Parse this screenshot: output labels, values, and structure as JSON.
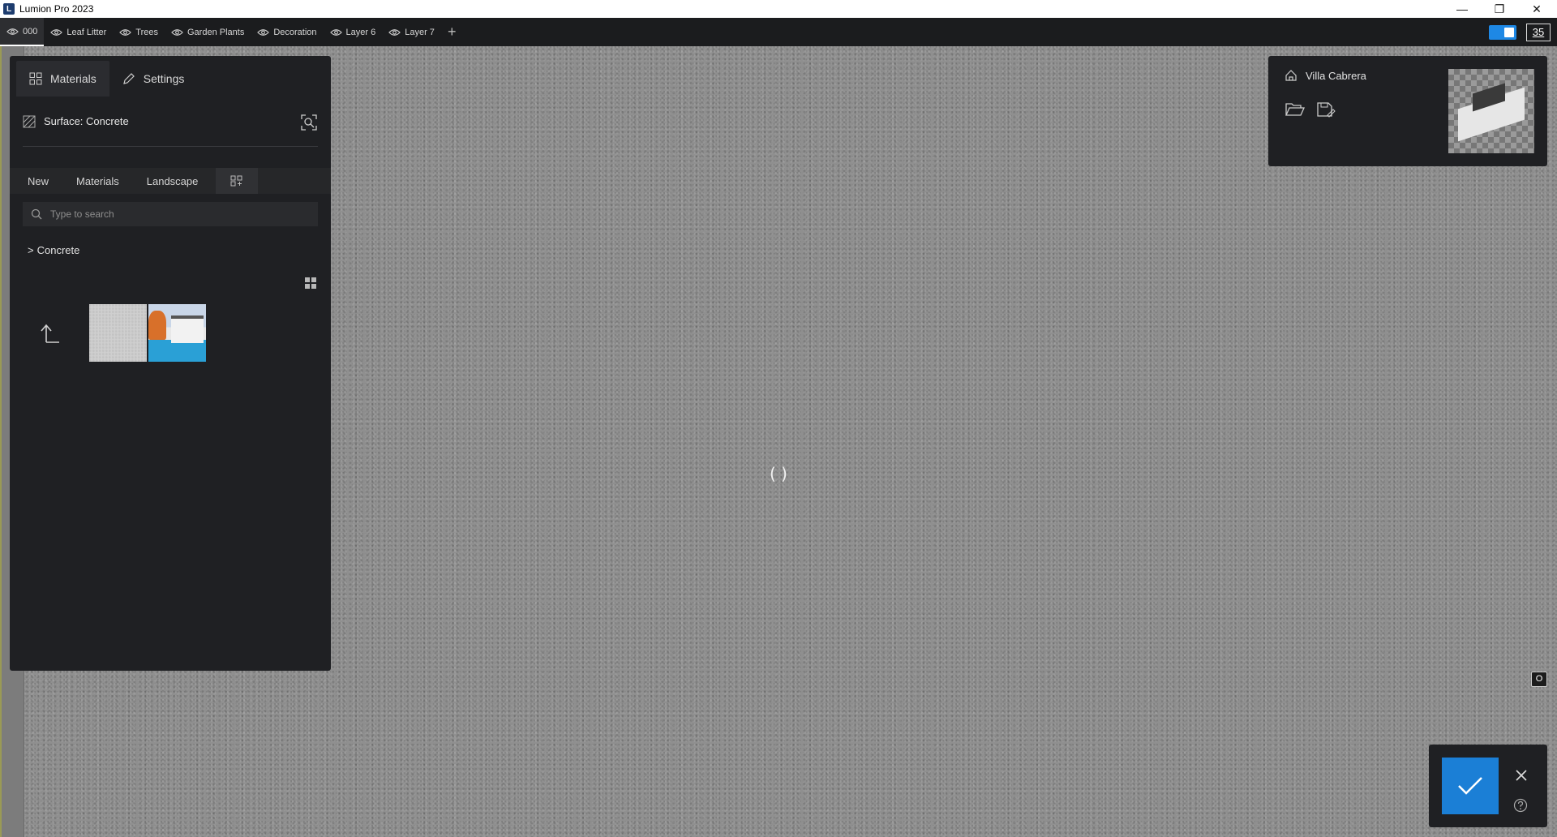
{
  "window": {
    "title": "Lumion Pro 2023",
    "logo_letter": "L",
    "minimize_glyph": "—",
    "restore_glyph": "❐",
    "close_glyph": "✕"
  },
  "layers": {
    "items": [
      {
        "label": "000",
        "active": true
      },
      {
        "label": "Leaf Litter"
      },
      {
        "label": "Trees"
      },
      {
        "label": "Garden Plants"
      },
      {
        "label": "Decoration"
      },
      {
        "label": "Layer 6"
      },
      {
        "label": "Layer 7"
      }
    ],
    "add_glyph": "+",
    "counter": "35"
  },
  "panel": {
    "tabs": {
      "materials": "Materials",
      "settings": "Settings"
    },
    "surface_label": "Surface: Concrete",
    "subtabs": {
      "new": "New",
      "materials": "Materials",
      "landscape": "Landscape"
    },
    "search_placeholder": "Type to search",
    "folder": {
      "chevron": ">",
      "name": "Concrete"
    }
  },
  "project": {
    "name": "Villa Cabrera"
  },
  "viewport": {
    "crosshair": "( )",
    "map_badge": "O"
  },
  "icons": [
    "eye-icon",
    "materials-grid-icon",
    "pencil-icon",
    "surface-texture-icon",
    "pick-material-icon",
    "grid-add-icon",
    "search-icon",
    "view-grid-icon",
    "up-level-icon",
    "house-icon",
    "folder-open-icon",
    "save-as-icon",
    "check-icon",
    "close-icon",
    "help-icon"
  ],
  "colors": {
    "accent": "#1b7fd6",
    "panel_bg": "#1f2023",
    "toggle": "#1e88e5"
  }
}
